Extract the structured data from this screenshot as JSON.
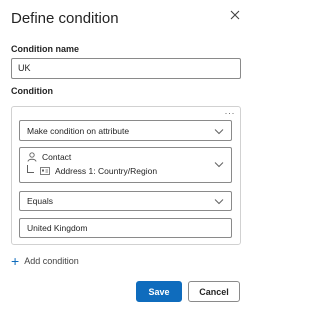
{
  "dialog": {
    "title": "Define condition",
    "close_icon": "close-icon"
  },
  "name_section": {
    "label": "Condition name",
    "value": "UK"
  },
  "condition_section": {
    "label": "Condition",
    "more_icon": "more-options-icon",
    "ellipsis": "···",
    "type_select": {
      "value": "Make condition on attribute"
    },
    "attribute_picker": {
      "entity_icon": "person-icon",
      "entity": "Contact",
      "attribute_icon": "address-card-icon",
      "attribute": "Address 1: Country/Region"
    },
    "operator_select": {
      "value": "Equals"
    },
    "value_input": {
      "value": "United Kingdom"
    }
  },
  "add_condition": {
    "icon": "plus-icon",
    "label": "Add condition"
  },
  "footer": {
    "save_label": "Save",
    "cancel_label": "Cancel"
  },
  "colors": {
    "accent": "#0f6cbd",
    "border": "#8a8a8a",
    "text": "#242424"
  }
}
